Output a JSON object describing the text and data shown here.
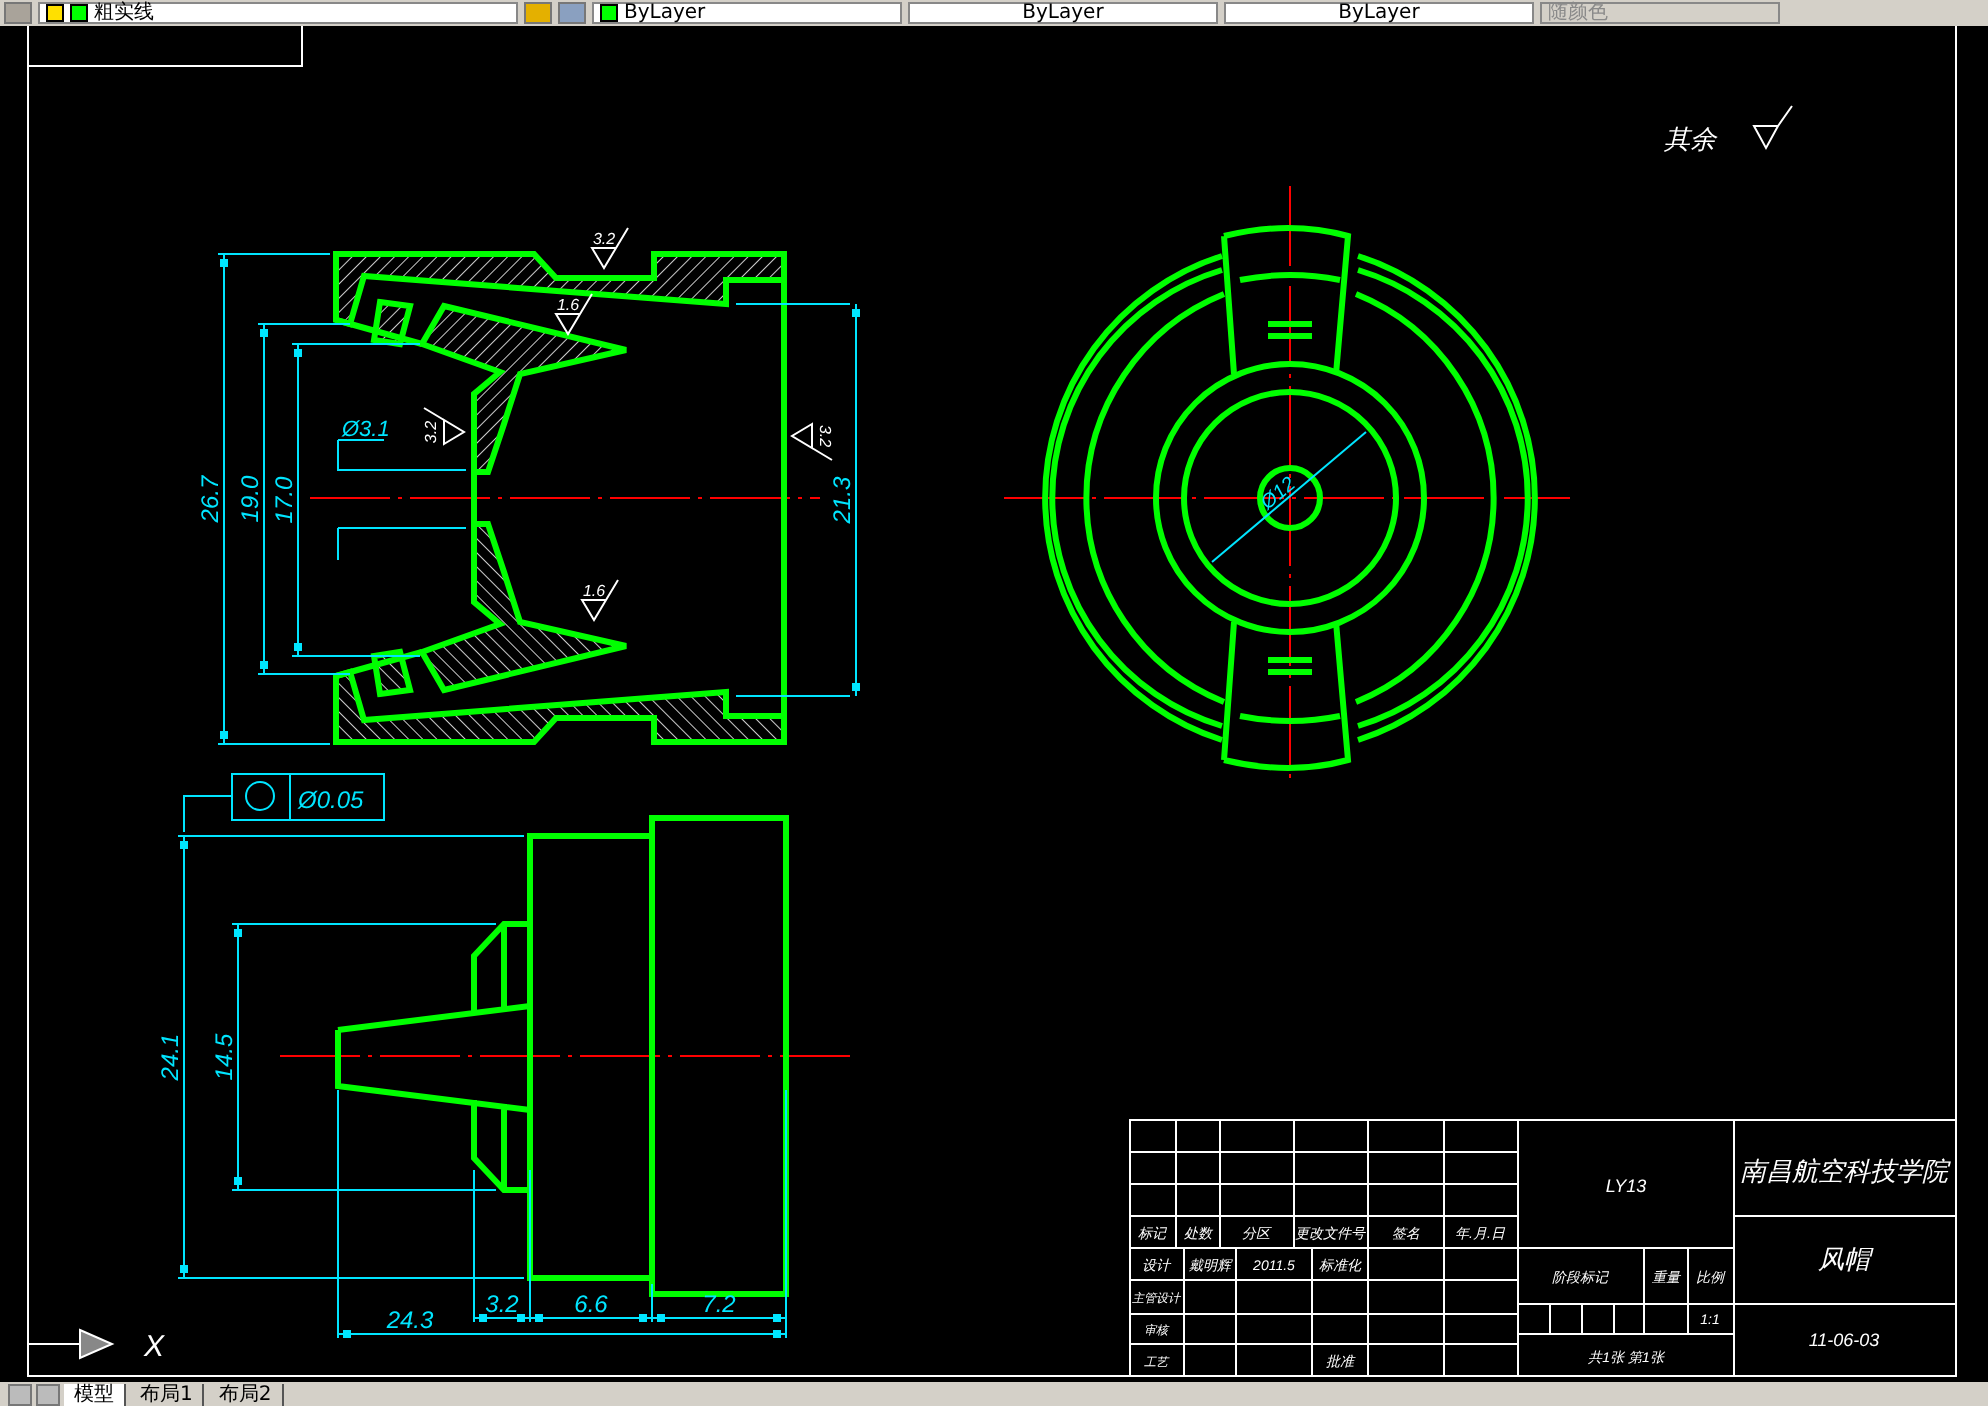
{
  "toolbar": {
    "layer": "粗实线",
    "color_control": "ByLayer",
    "linetype": "ByLayer",
    "lineweight": "ByLayer",
    "plot_style": {
      "label": "随颜色",
      "disabled": true
    }
  },
  "drawing": {
    "note": "其余",
    "section_dims": [
      "26.7",
      "19.0",
      "17.0",
      "Ø3.1",
      "21.3"
    ],
    "roughness": [
      "3.2",
      "1.6",
      "3.2",
      "3.2",
      "1.6"
    ],
    "end_dims": [
      "Ø12"
    ],
    "tolerance": "Ø0.05",
    "side_dims": [
      "24.1",
      "14.5",
      "24.3",
      "3.2",
      "6.6",
      "7.2"
    ],
    "ucs_axis": "X"
  },
  "title_block": {
    "material": "LY13",
    "school": "南昌航空科技学院",
    "part_name": "风帽",
    "drawing_no": "11-06-03",
    "headers": [
      "标记",
      "处数",
      "分区",
      "更改文件号",
      "签名",
      "年.月.日"
    ],
    "design_row": [
      "设计",
      "戴明辉",
      "2011.5",
      "标准化"
    ],
    "labels": [
      "主管设计",
      "审核",
      "工艺"
    ],
    "approve": "批准",
    "stage_headers": [
      "阶段标记",
      "重量",
      "比例"
    ],
    "scale": "1:1",
    "sheets": "共1张 第1张"
  },
  "layout_tabs": [
    {
      "label": "模型",
      "selected": true
    },
    {
      "label": "布局1",
      "selected": false
    },
    {
      "label": "布局2",
      "selected": false
    }
  ]
}
